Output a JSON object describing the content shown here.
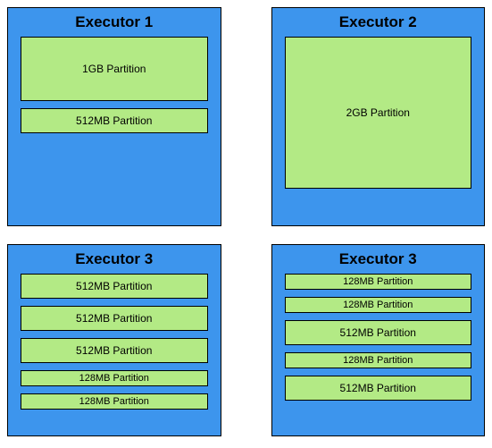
{
  "executors": [
    {
      "title": "Executor 1",
      "partitions": [
        {
          "label": "1GB Partition",
          "size": "1gb"
        },
        {
          "label": "512MB Partition",
          "size": "512"
        }
      ]
    },
    {
      "title": "Executor 2",
      "partitions": [
        {
          "label": "2GB Partition",
          "size": "2gb"
        }
      ]
    },
    {
      "title": "Executor 3",
      "partitions": [
        {
          "label": "512MB Partition",
          "size": "512"
        },
        {
          "label": "512MB Partition",
          "size": "512"
        },
        {
          "label": "512MB Partition",
          "size": "512"
        },
        {
          "label": "128MB Partition",
          "size": "128"
        },
        {
          "label": "128MB Partition",
          "size": "128"
        }
      ]
    },
    {
      "title": "Executor 3",
      "partitions": [
        {
          "label": "128MB Partition",
          "size": "128"
        },
        {
          "label": "128MB Partition",
          "size": "128"
        },
        {
          "label": "512MB Partition",
          "size": "512"
        },
        {
          "label": "128MB Partition",
          "size": "128"
        },
        {
          "label": "512MB Partition",
          "size": "512"
        }
      ]
    }
  ]
}
